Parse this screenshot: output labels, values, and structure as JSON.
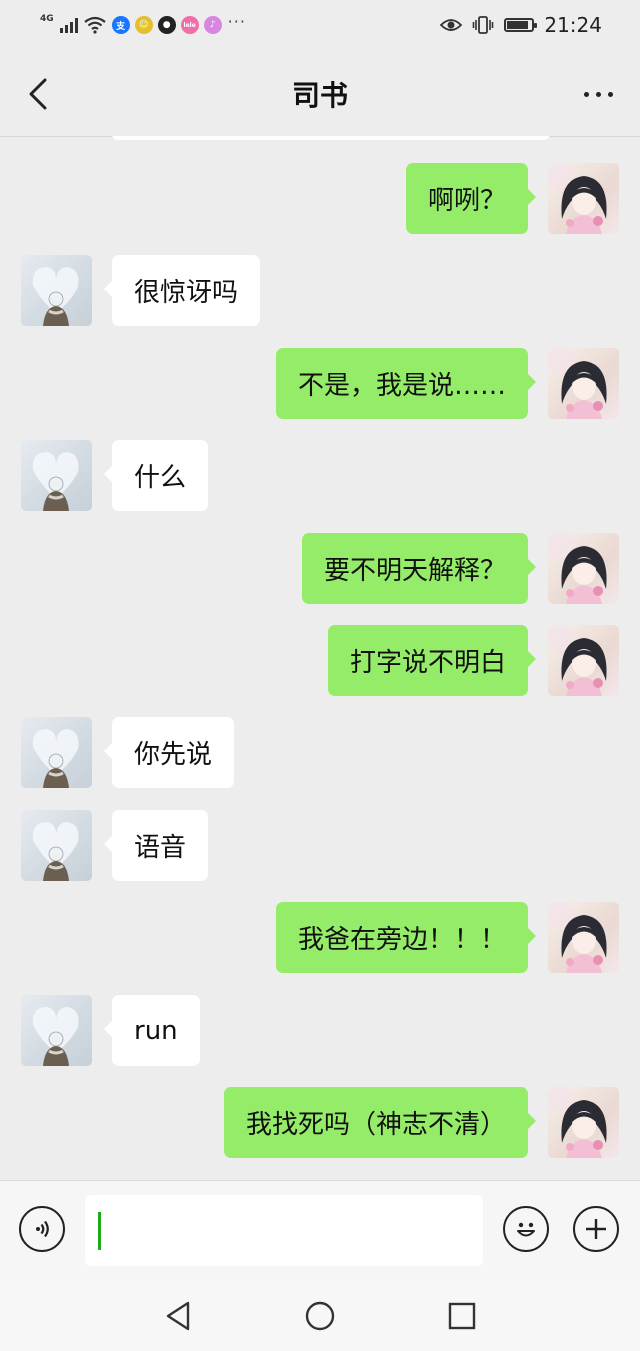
{
  "status_bar": {
    "network": "4G",
    "apps": [
      {
        "icon": "alipay-icon",
        "label": "支",
        "color": "#1677ff"
      },
      {
        "icon": "app-yellow-icon",
        "label": "☺",
        "color": "#e3c02c"
      },
      {
        "icon": "game-icon",
        "label": "●",
        "color": "#222222"
      },
      {
        "icon": "app-pink-icon",
        "label": "lele",
        "color": "#f06ea9"
      },
      {
        "icon": "music-icon",
        "label": "♪",
        "color": "#d887e0"
      }
    ],
    "more": "···",
    "time": "21:24",
    "battery_level": 0.85
  },
  "header": {
    "title": "司书"
  },
  "messages": [
    {
      "side": "right",
      "text": "啊咧？"
    },
    {
      "side": "left",
      "text": "很惊讶吗"
    },
    {
      "side": "right",
      "text": "不是，我是说……"
    },
    {
      "side": "left",
      "text": "什么"
    },
    {
      "side": "right",
      "text": "要不明天解释？"
    },
    {
      "side": "right",
      "text": "打字说不明白"
    },
    {
      "side": "left",
      "text": "你先说"
    },
    {
      "side": "left",
      "text": "语音"
    },
    {
      "side": "right",
      "text": "我爸在旁边！！！"
    },
    {
      "side": "left",
      "text": "run"
    },
    {
      "side": "right",
      "text": "我找死吗（神志不清）"
    }
  ],
  "input": {
    "value": "",
    "placeholder": ""
  },
  "colors": {
    "background": "#ededed",
    "sent_bubble": "#95ec69",
    "received_bubble": "#ffffff",
    "cursor": "#1aad19"
  }
}
